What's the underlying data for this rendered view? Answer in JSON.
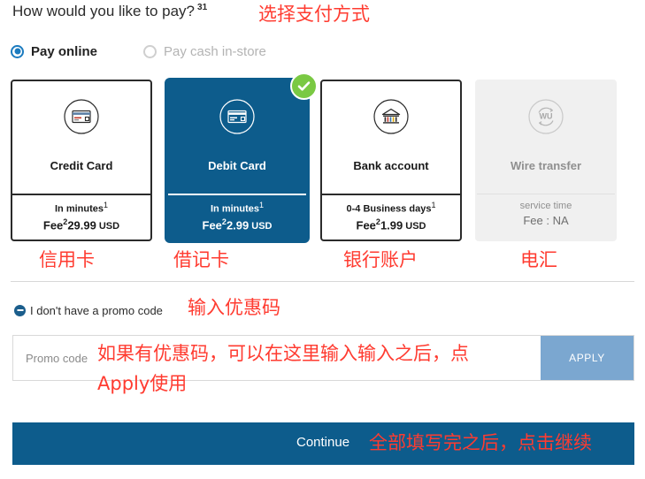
{
  "header": {
    "title": "How would you like to pay?",
    "title_superscript": "31",
    "annotation": "选择支付方式"
  },
  "pay_mode": {
    "options": [
      {
        "label": "Pay online",
        "selected": true,
        "disabled": false,
        "icon": "radio-selected-icon"
      },
      {
        "label": "Pay cash in-store",
        "selected": false,
        "disabled": true,
        "icon": "radio-unselected-icon"
      }
    ]
  },
  "payment_methods": [
    {
      "name": "Credit Card",
      "icon": "credit-card-icon",
      "time": "In minutes",
      "time_superscript": "1",
      "fee_label": "Fee",
      "fee_superscript": "2",
      "fee_amount": "29.99",
      "currency": "USD",
      "selected": false,
      "disabled": false,
      "annotation": "信用卡"
    },
    {
      "name": "Debit Card",
      "icon": "debit-card-icon",
      "time": "In minutes",
      "time_superscript": "1",
      "fee_label": "Fee",
      "fee_superscript": "2",
      "fee_amount": "2.99",
      "currency": "USD",
      "selected": true,
      "disabled": false,
      "annotation": "借记卡"
    },
    {
      "name": "Bank account",
      "icon": "bank-icon",
      "time": "0-4 Business days",
      "time_superscript": "1",
      "fee_label": "Fee",
      "fee_superscript": "2",
      "fee_amount": "1.99",
      "currency": "USD",
      "selected": false,
      "disabled": false,
      "annotation": "银行账户"
    },
    {
      "name": "Wire transfer",
      "icon": "western-union-icon",
      "time": "service time",
      "time_superscript": "",
      "fee_text": "Fee : NA",
      "selected": false,
      "disabled": true,
      "annotation": "电汇"
    }
  ],
  "selected_badge": {
    "icon": "green-check-icon",
    "color": "#7ac943"
  },
  "promo": {
    "toggle_label": "I don't have a promo code",
    "toggle_icon": "minus-circle-icon",
    "toggle_annotation": "输入优惠码",
    "input_placeholder": "Promo code",
    "input_value": "",
    "apply_label": "APPLY",
    "apply_color": "#7ba7d0",
    "annotation_line1": "如果有优惠码，可以在这里输入输入之后，点",
    "annotation_line2": "Apply使用"
  },
  "continue": {
    "label": "Continue",
    "color": "#0d5c8c",
    "annotation": "全部填写完之后，点击继续"
  },
  "annotation_color": "#ff3b30"
}
